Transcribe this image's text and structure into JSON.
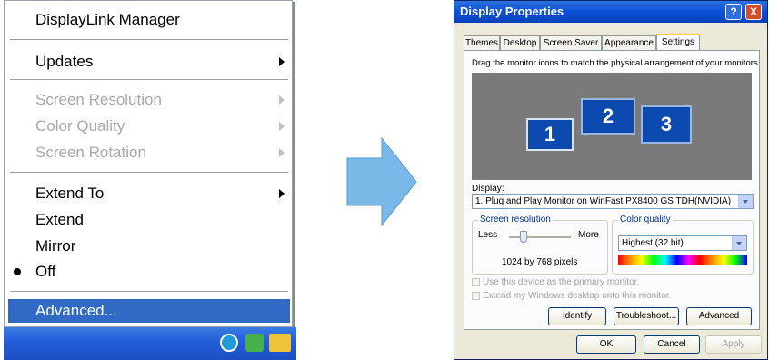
{
  "menu": {
    "items": [
      {
        "label": "DisplayLink Manager"
      },
      {
        "label": "Updates"
      },
      {
        "label": "Screen Resolution"
      },
      {
        "label": "Color Quality"
      },
      {
        "label": "Screen Rotation"
      },
      {
        "label": "Extend To"
      },
      {
        "label": "Extend"
      },
      {
        "label": "Mirror"
      },
      {
        "label": "Off"
      },
      {
        "label": "Advanced..."
      }
    ]
  },
  "dialog": {
    "title": "Display Properties",
    "tabs": [
      "Themes",
      "Desktop",
      "Screen Saver",
      "Appearance",
      "Settings"
    ],
    "instruction": "Drag the monitor icons to match the physical arrangement of your monitors.",
    "monitors": [
      "1",
      "2",
      "3"
    ],
    "display_label": "Display:",
    "display_value": "1. Plug and Play Monitor on WinFast PX8400 GS TDH(NVIDIA)",
    "resolution_legend": "Screen resolution",
    "less": "Less",
    "more": "More",
    "resolution_value": "1024 by 768 pixels",
    "color_legend": "Color quality",
    "color_value": "Highest (32 bit)",
    "primary_check": "Use this device as the primary monitor.",
    "extend_check": "Extend my Windows desktop onto this monitor.",
    "identify": "Identify",
    "troubleshoot": "Troubleshoot...",
    "advanced": "Advanced",
    "ok": "OK",
    "cancel": "Cancel",
    "apply": "Apply",
    "help_icon": "?",
    "close_icon": "X"
  },
  "colors": {
    "menu_highlight": "#316ac5",
    "monitor_blue": "#0c4ab0",
    "arrow_blue": "#7ab8e8"
  }
}
